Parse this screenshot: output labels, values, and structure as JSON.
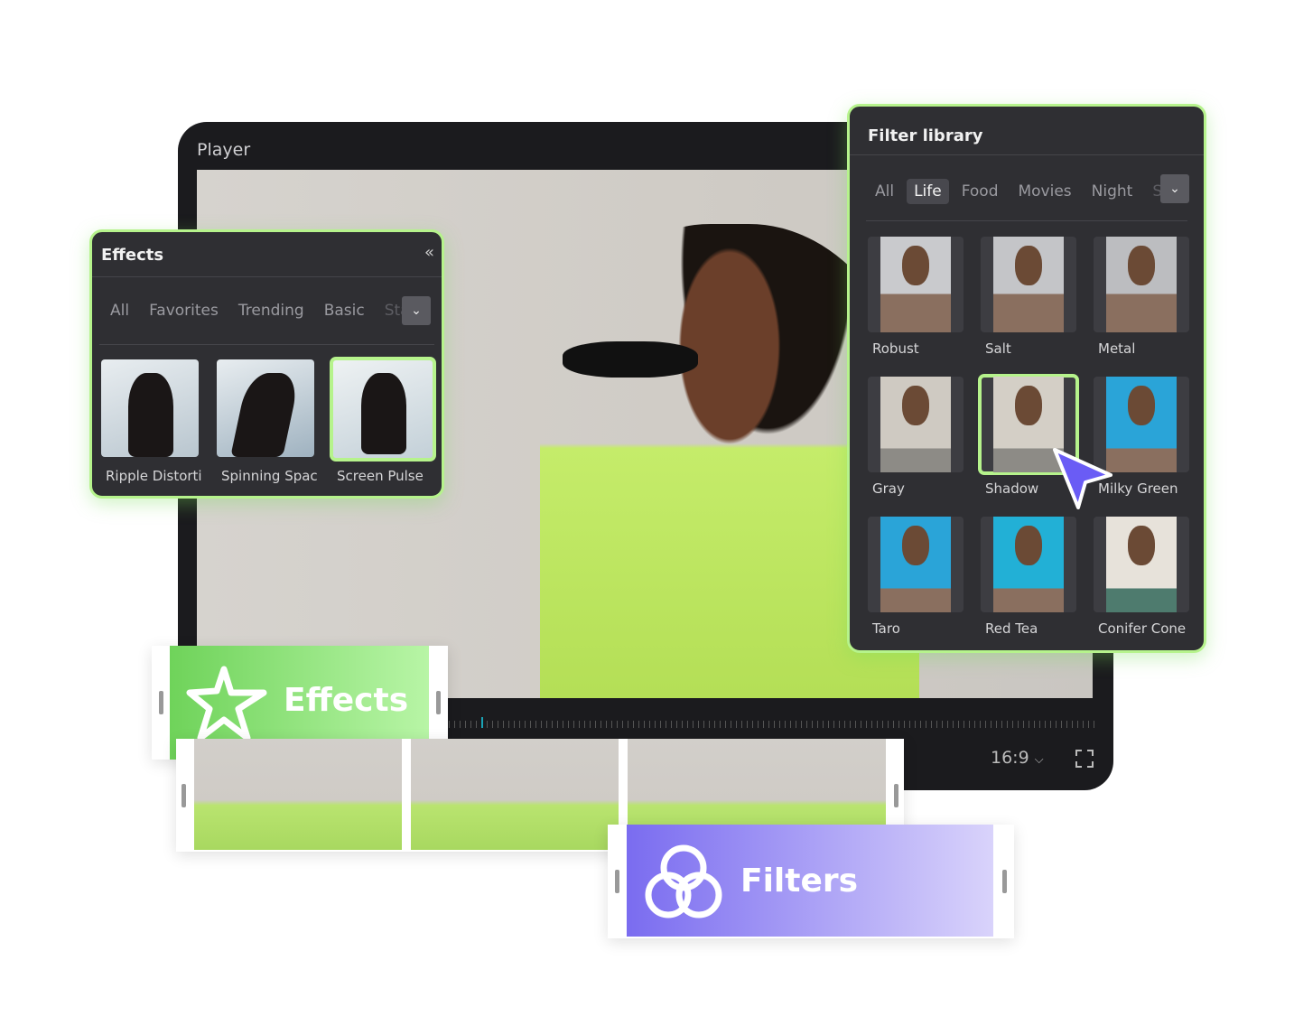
{
  "player": {
    "title": "Player",
    "aspect_ratio": "16:9",
    "progress_percent": 5
  },
  "effects_panel": {
    "title": "Effects",
    "tabs": [
      "All",
      "Favorites",
      "Trending",
      "Basic",
      "Sta"
    ],
    "items": [
      {
        "label": "Ripple Distorti"
      },
      {
        "label": "Spinning Spac"
      },
      {
        "label": "Screen Pulse",
        "selected": true
      }
    ]
  },
  "filter_panel": {
    "title": "Filter library",
    "tabs": [
      "All",
      "Life",
      "Food",
      "Movies",
      "Night",
      "Sc"
    ],
    "active_tab": "Life",
    "items": [
      {
        "label": "Robust"
      },
      {
        "label": "Salt"
      },
      {
        "label": "Metal"
      },
      {
        "label": "Gray"
      },
      {
        "label": "Shadow",
        "selected": true
      },
      {
        "label": "Milky Green"
      },
      {
        "label": "Taro"
      },
      {
        "label": "Red Tea"
      },
      {
        "label": "Conifer Cone"
      }
    ]
  },
  "clips": {
    "effects_label": "Effects",
    "filters_label": "Filters"
  },
  "colors": {
    "accent_green": "#b6f38c",
    "filters_purple": "#7b6cf0",
    "cursor": "#6a5cf5"
  }
}
